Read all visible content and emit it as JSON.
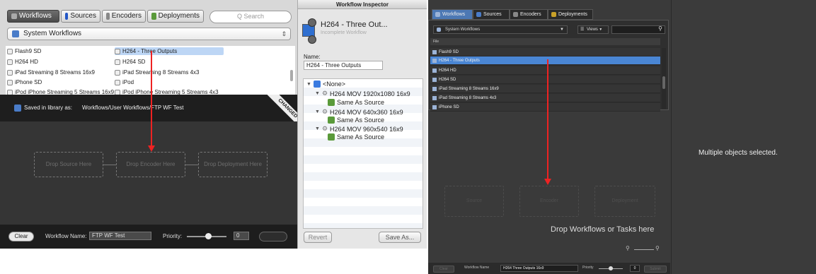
{
  "left": {
    "tabs": [
      {
        "label": "Workflows"
      },
      {
        "label": "Sources"
      },
      {
        "label": "Encoders"
      },
      {
        "label": "Deployments"
      }
    ],
    "search_placeholder": "Q Search",
    "library_select": "System Workflows",
    "workflows": [
      "Flash9 SD",
      "H264 HD",
      "iPad Streaming 8 Streams 16x9",
      "iPhone SD",
      "iPod iPhone Streaming 5 Streams 16x9",
      "H264 - Three Outputs",
      "H264 SD",
      "iPad Streaming 8 Streams 4x3",
      "iPod",
      "iPod iPhone Streaming 5 Streams 4x3"
    ],
    "saved_label": "Saved in library as:",
    "saved_path": "Workflows/User Workflows/FTP WF Test",
    "changed_ribbon": "CHANGED",
    "drop_source": "Drop Source Here",
    "drop_encoder": "Drop Encoder Here",
    "drop_deployment": "Drop Deployment Here",
    "clear_label": "Clear",
    "workflow_name_label": "Workflow Name:",
    "workflow_name_value": "FTP WF Test",
    "priority_label": "Priority:",
    "priority_value": "0"
  },
  "inspector": {
    "title": "Workflow Inspector",
    "workflow_title": "H264 - Three Out...",
    "status": "Incomplete Workflow",
    "name_label": "Name:",
    "name_value": "H264 - Three Outputs",
    "tree": {
      "root": "<None>",
      "nodes": [
        {
          "label": "H264 MOV 1920x1080 16x9",
          "child": "Same As Source"
        },
        {
          "label": "H264 MOV 640x360 16x9",
          "child": "Same As Source"
        },
        {
          "label": "H264 MOV 960x540 16x9",
          "child": "Same As Source"
        }
      ]
    },
    "revert_label": "Revert",
    "saveas_label": "Save As..."
  },
  "right": {
    "tabs": [
      {
        "label": "Workflows"
      },
      {
        "label": "Sources"
      },
      {
        "label": "Encoders"
      },
      {
        "label": "Deployments"
      }
    ],
    "library_select": "System Workflows",
    "views_label": "Views",
    "column_header": "File",
    "workflows": [
      "Flash9 SD",
      "H264 - Three Outputs",
      "H264 HD",
      "H264 SD",
      "iPad Streaming 8 Streams 16x9",
      "iPad Streaming 8 Streams 4x3",
      "iPhone SD"
    ],
    "drop_source": "Source",
    "drop_encoder": "Encoder",
    "drop_deployment": "Deployment",
    "drop_hint": "Drop Workflows or Tasks here",
    "multiple_selected": "Multiple objects selected.",
    "clear_label": "Clear",
    "workflow_name_label": "Workflow Name",
    "workflow_name_value": "H264 Three Outputs 16x9",
    "priority_label": "Priority",
    "priority_value": "0",
    "submit_label": "Submit"
  },
  "colors": {
    "accent_blue": "#4a86d4",
    "arrow_red": "#e22222",
    "changed_ribbon": "#2a2a2a"
  }
}
